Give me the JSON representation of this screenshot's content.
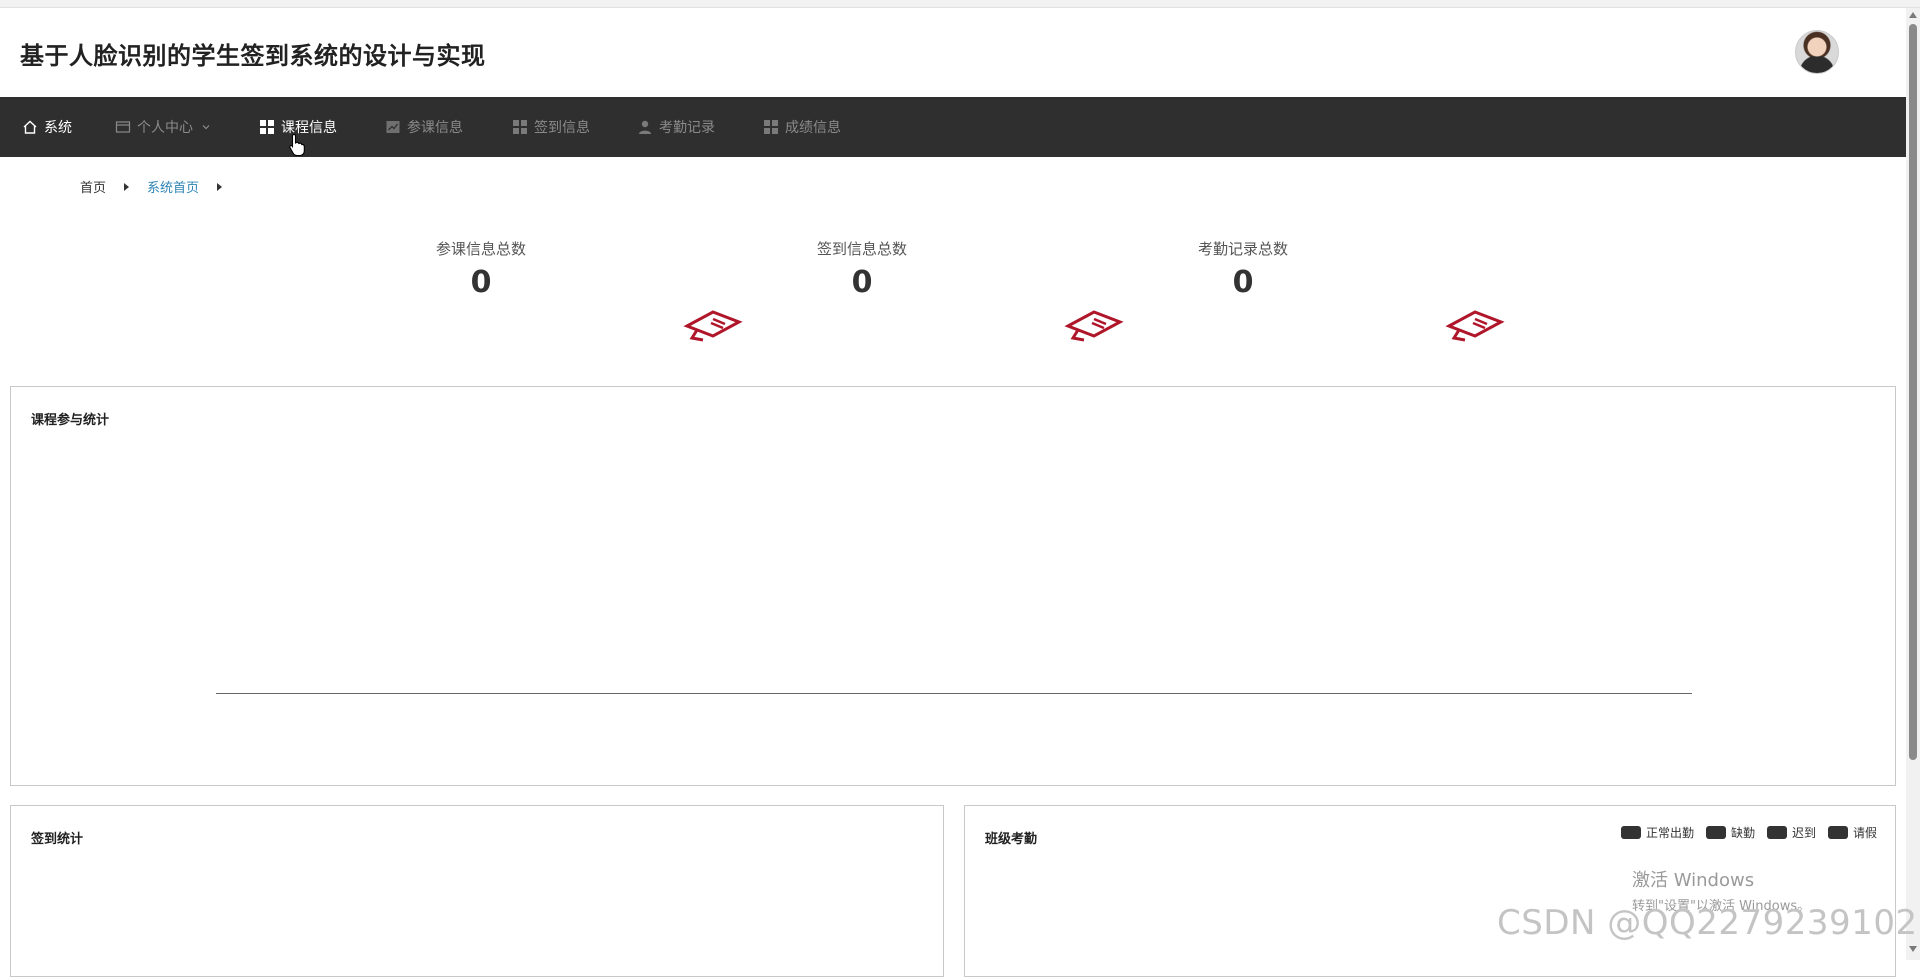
{
  "app": {
    "title": "基于人脸识别的学生签到系统的设计与实现"
  },
  "nav": {
    "items": [
      {
        "label": "系统",
        "icon": "home-icon"
      },
      {
        "label": "个人中心",
        "icon": "id-card-icon",
        "has_dropdown": true
      },
      {
        "label": "课程信息",
        "icon": "grid-icon",
        "hovered": true
      },
      {
        "label": "参课信息",
        "icon": "chart-icon"
      },
      {
        "label": "签到信息",
        "icon": "grid-icon"
      },
      {
        "label": "考勤记录",
        "icon": "user-icon"
      },
      {
        "label": "成绩信息",
        "icon": "grid-icon"
      }
    ]
  },
  "breadcrumb": {
    "home": "首页",
    "current": "系统首页"
  },
  "stats": [
    {
      "label": "参课信息总数",
      "value": "0",
      "icon": "ticket-icon"
    },
    {
      "label": "签到信息总数",
      "value": "0",
      "icon": "ticket-icon"
    },
    {
      "label": "考勤记录总数",
      "value": "0",
      "icon": "ticket-icon"
    }
  ],
  "panels": {
    "course_stats": {
      "title": "课程参与统计"
    },
    "checkin_stats": {
      "title": "签到统计"
    },
    "class_attendance": {
      "title": "班级考勤",
      "legend": [
        "正常出勤",
        "缺勤",
        "迟到",
        "请假"
      ]
    }
  },
  "overlay": {
    "windows_activation": {
      "line1": "激活 Windows",
      "line2": "转到\"设置\"以激活 Windows。"
    },
    "watermark": "CSDN @QQ2279239102"
  },
  "colors": {
    "nav_bg": "#2f2f2f",
    "accent_red": "#b0162a",
    "breadcrumb_link": "#2e84b5"
  }
}
